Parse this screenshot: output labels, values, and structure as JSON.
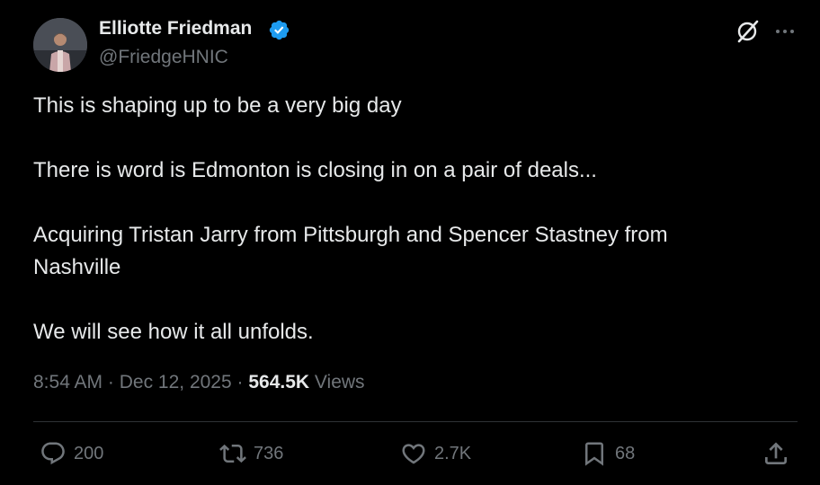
{
  "author": {
    "name": "Elliotte Friedman",
    "handle": "@FriedgeHNIC"
  },
  "post": {
    "lines": [
      "This is shaping up to be a very big day",
      "There is word is Edmonton is closing in on a pair of deals...",
      "Acquiring Tristan Jarry from Pittsburgh and Spencer Stastney from",
      "Nashville",
      "We will see how it all unfolds."
    ]
  },
  "meta": {
    "time": "8:54 AM",
    "sep1": " · ",
    "date": "Dec 12, 2025",
    "sep2": " · ",
    "views_count": "564.5K",
    "views_label": " Views"
  },
  "actions": {
    "replies": "200",
    "reposts": "736",
    "likes": "2.7K",
    "bookmarks": "68"
  },
  "icons": {
    "verified": "verified-badge-icon",
    "grok": "grok-icon",
    "more": "more-icon",
    "reply": "reply-icon",
    "repost": "repost-icon",
    "like": "heart-icon",
    "bookmark": "bookmark-icon",
    "share": "share-icon"
  },
  "colors": {
    "background": "#000000",
    "text": "#e7e9ea",
    "muted": "#71767b",
    "verified": "#1d9bf0",
    "divider": "#2f3336"
  }
}
